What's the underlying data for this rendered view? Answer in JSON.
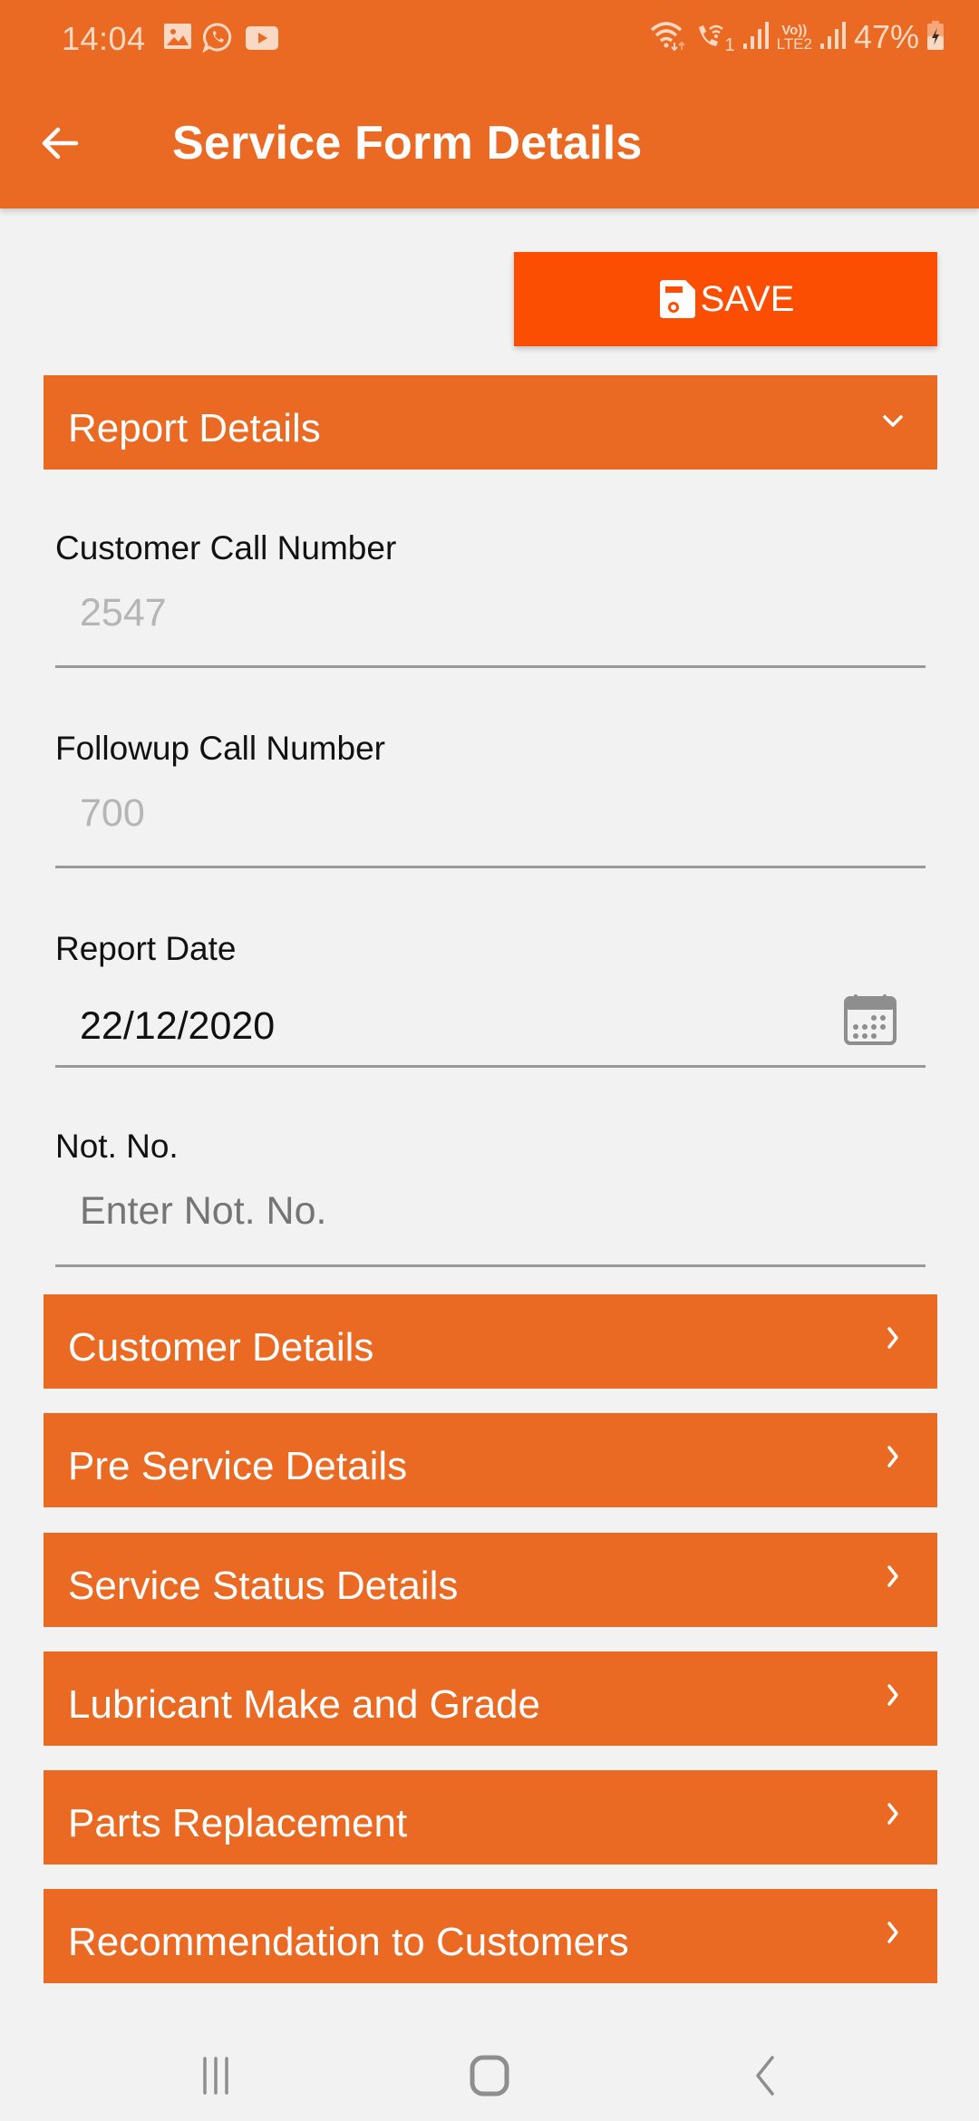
{
  "status_bar": {
    "time": "14:04",
    "notification_icons": [
      "gallery-icon",
      "whatsapp-icon",
      "youtube-icon"
    ],
    "system_icons": [
      "wifi-icon",
      "wifi-calling-icon",
      "signal-sim1-icon",
      "volte-lte2-icon",
      "signal-sim2-icon"
    ],
    "sim1_label": "1",
    "volte_label_top": "Vo))",
    "volte_label_bottom": "LTE2",
    "battery_percent": "47%"
  },
  "header": {
    "title": "Service Form Details",
    "back_icon": "arrow-left-icon"
  },
  "toolbar": {
    "save_label": "SAVE",
    "save_icon": "floppy-disk-icon"
  },
  "colors": {
    "primary": "#EB6A23",
    "save_button": "#FC4E03",
    "background": "#F2F2F2"
  },
  "report_details": {
    "label": "Report Details",
    "expanded": true,
    "fields": [
      {
        "label": "Customer Call Number",
        "value": "2547",
        "placeholder": "",
        "enabled": false
      },
      {
        "label": "Followup Call Number",
        "value": "700",
        "placeholder": "",
        "enabled": false
      },
      {
        "label": "Report Date",
        "value": "22/12/2020",
        "placeholder": "",
        "enabled": true,
        "icon": "calendar-icon"
      },
      {
        "label": "Not. No.",
        "value": "",
        "placeholder": "Enter Not. No.",
        "enabled": true
      }
    ]
  },
  "sections": [
    {
      "label": "Customer Details"
    },
    {
      "label": "Pre Service Details"
    },
    {
      "label": "Service Status Details"
    },
    {
      "label": "Lubricant Make and Grade"
    },
    {
      "label": "Parts Replacement"
    },
    {
      "label": "Recommendation to Customers"
    }
  ],
  "nav_bar": {
    "buttons": [
      "recents-icon",
      "home-icon",
      "back-icon"
    ]
  }
}
